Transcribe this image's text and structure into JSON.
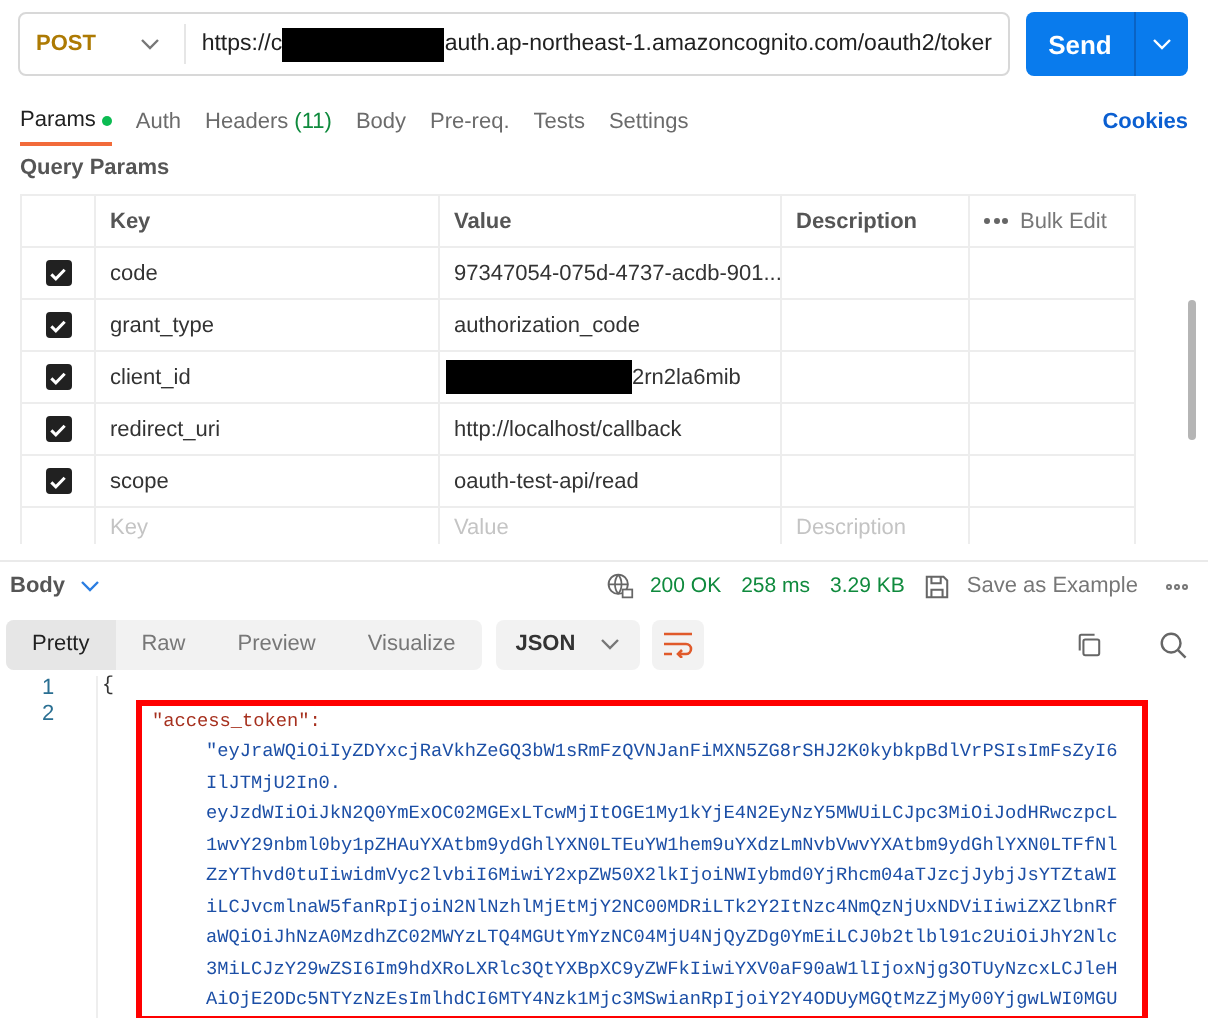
{
  "request": {
    "method": "POST",
    "url_start": "https://c",
    "url_redacted": true,
    "url_end": "auth.ap-northeast-1.amazoncognito.com/oauth2/toker",
    "send": "Send"
  },
  "tabs": [
    {
      "label": "Params",
      "indicator": true,
      "selected": true
    },
    {
      "label": "Auth",
      "indicator": false,
      "selected": false
    },
    {
      "label": "Headers",
      "count": "(11)",
      "indicator": false,
      "selected": false
    },
    {
      "label": "Body",
      "indicator": false,
      "selected": false
    },
    {
      "label": "Pre-req.",
      "indicator": false,
      "selected": false
    },
    {
      "label": "Tests",
      "indicator": false,
      "selected": false
    },
    {
      "label": "Settings",
      "indicator": false,
      "selected": false
    }
  ],
  "cookies": "Cookies",
  "section_title": "Query Params",
  "table": {
    "columns": [
      "Key",
      "Value",
      "Description"
    ],
    "bulk_edit": "Bulk Edit",
    "rows": [
      {
        "checked": true,
        "key": "code",
        "value": "97347054-075d-4737-acdb-901...",
        "redacted": false
      },
      {
        "checked": true,
        "key": "grant_type",
        "value": "authorization_code",
        "redacted": false
      },
      {
        "checked": true,
        "key": "client_id",
        "value": "2rn2la6mib",
        "redacted": true
      },
      {
        "checked": true,
        "key": "redirect_uri",
        "value": "http://localhost/callback",
        "redacted": false
      },
      {
        "checked": true,
        "key": "scope",
        "value": "oauth-test-api/read",
        "redacted": false
      }
    ],
    "placeholder_row": {
      "key": "Key",
      "value": "Value",
      "description": "Description"
    }
  },
  "response": {
    "body_label": "Body",
    "status": "200 OK",
    "time": "258 ms",
    "size": "3.29 KB",
    "save": "Save as Example",
    "view_tabs": [
      {
        "label": "Pretty",
        "selected": true
      },
      {
        "label": "Raw",
        "selected": false
      },
      {
        "label": "Preview",
        "selected": false
      },
      {
        "label": "Visualize",
        "selected": false
      }
    ],
    "format": "JSON",
    "lines": [
      {
        "number": "1",
        "text": "{",
        "highlighted": false
      },
      {
        "number": "2",
        "highlighted": true,
        "key": "\"access_token\":",
        "value_lines": [
          "\"eyJraWQiOiIyZDYxcjRaVkhZeGQ3bW1sRmFzQVNJanFiMXN5ZG8rSHJ2K0kybkpBdlVrPSIsImFsZyI6",
          "IlJTMjU2In0.",
          "eyJzdWIiOiJkN2Q0YmExOC02MGExLTcwMjItOGE1My1kYjE4N2EyNzY5MWUiLCJpc3MiOiJodHRwczpcL",
          "1wvY29nbml0by1pZHAuYXAtbm9ydGhlYXN0LTEuYW1hem9uYXdzLmNvbVwvYXAtbm9ydGhlYXN0LTFfNl",
          "ZzYThvd0tuIiwidmVyc2lvbiI6MiwiY2xpZW50X2lkIjoiNWIybmd0YjRhcm04aTJzcjJybjJsYTZtaWI",
          "iLCJvcmlnaW5fanRpIjoiN2NlNzhlMjEtMjY2NC00MDRiLTk2Y2ItNzc4NmQzNjUxNDViIiwiZXZlbnRf",
          "aWQiOiJhNzA0MzdhZC02MWYzLTQ4MGUtYmYzNC04MjU4NjQyZDg0YmEiLCJ0b2tlbl91c2UiOiJhY2Nlc",
          "3MiLCJzY29wZSI6Im9hdXRoLXRlc3QtYXBpXC9yZWFkIiwiYXV0aF90aW1lIjoxNjg3OTUyNzcxLCJleH",
          "AiOjE2ODc5NTYzNzEsImlhdCI6MTY4Nzk1Mjc3MSwianRpIjoiY2Y4ODUyMGQtMzZjMy00YjgwLWI0MGU"
        ]
      }
    ]
  }
}
